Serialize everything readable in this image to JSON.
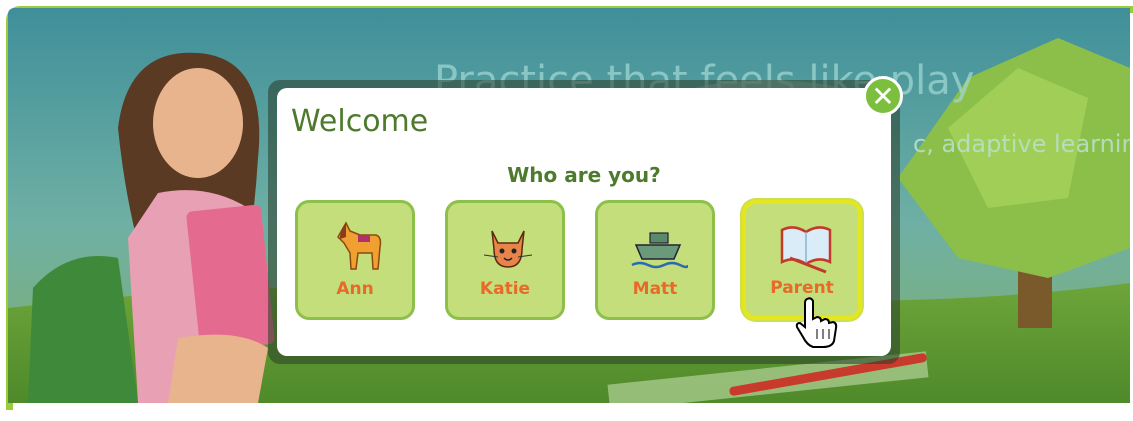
{
  "hero": {
    "tagline": "Practice that feels like play",
    "subline": "c, adaptive learnin"
  },
  "dialog": {
    "title": "Welcome",
    "question": "Who are you?",
    "close_icon": "close-icon"
  },
  "profiles": [
    {
      "label": "Ann",
      "icon": "horse-icon",
      "selected": false
    },
    {
      "label": "Katie",
      "icon": "cat-icon",
      "selected": false
    },
    {
      "label": "Matt",
      "icon": "boat-icon",
      "selected": false
    },
    {
      "label": "Parent",
      "icon": "book-icon",
      "selected": true
    }
  ],
  "colors": {
    "frame": "#9ccc3a",
    "dialog_text": "#4d7a2c",
    "tile_bg": "#c3de7a",
    "tile_border": "#8dc04a",
    "tile_label": "#e86a2a",
    "selected_border": "#e6e61e",
    "close_bg": "#7cbf3e"
  }
}
